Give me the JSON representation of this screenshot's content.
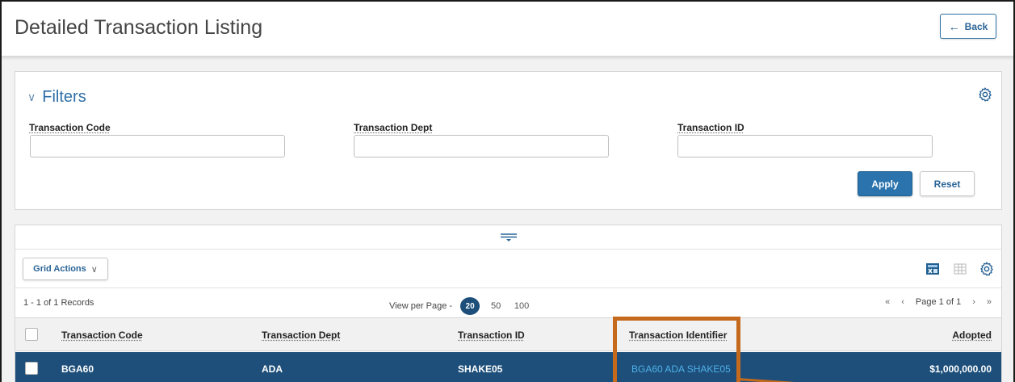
{
  "header": {
    "title": "Detailed Transaction Listing",
    "back_label": "Back"
  },
  "filters": {
    "title": "Filters",
    "fields": [
      {
        "label": "Transaction Code",
        "value": ""
      },
      {
        "label": "Transaction Dept",
        "value": ""
      },
      {
        "label": "Transaction ID",
        "value": ""
      }
    ],
    "apply_label": "Apply",
    "reset_label": "Reset"
  },
  "grid": {
    "actions_label": "Grid Actions",
    "records_text": "1 - 1 of 1 Records",
    "view_per_page_label": "View per Page -",
    "page_sizes": [
      "20",
      "50",
      "100"
    ],
    "active_page_size": "20",
    "page_text": "Page 1 of 1",
    "columns": [
      "Transaction Code",
      "Transaction Dept",
      "Transaction ID",
      "Transaction Identifier",
      "Adopted"
    ],
    "rows": [
      {
        "code": "BGA60",
        "dept": "ADA",
        "id": "SHAKE05",
        "identifier": "BGA60 ADA SHAKE05",
        "adopted": "$1,000,000.00"
      }
    ]
  },
  "colors": {
    "accent": "#2a73ad",
    "selected_row": "#1d4f7a",
    "link": "#4fb0e8",
    "highlight": "#c56a1c"
  },
  "icons": [
    "back-arrow-icon",
    "chevron-down-icon",
    "gear-icon",
    "collapse-icon",
    "export-excel-icon",
    "grid-view-icon",
    "first-page-icon",
    "prev-page-icon",
    "next-page-icon",
    "last-page-icon"
  ]
}
